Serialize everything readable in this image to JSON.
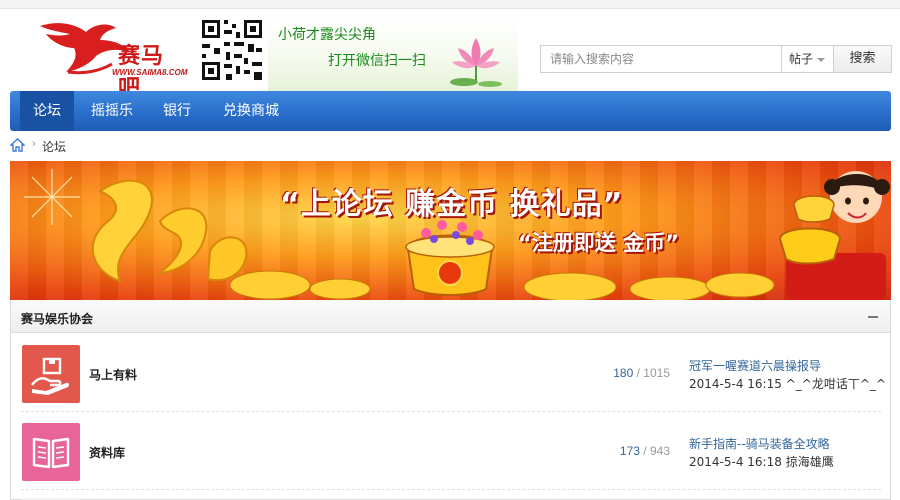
{
  "brand": {
    "logo_text": "赛马吧",
    "logo_url": "WWW.SAIMA8.COM",
    "brand_color": "#d01818"
  },
  "promo": {
    "line1": "小荷才露尖尖角",
    "line2": "打开微信扫一扫"
  },
  "search": {
    "placeholder": "请输入搜索内容",
    "type_label": "帖子",
    "button_label": "搜索"
  },
  "nav": {
    "items": [
      {
        "label": "论坛",
        "active": true
      },
      {
        "label": "摇摇乐",
        "active": false
      },
      {
        "label": "银行",
        "active": false
      },
      {
        "label": "兑换商城",
        "active": false
      }
    ],
    "color": "#2a6fcb"
  },
  "breadcrumb": {
    "current": "论坛"
  },
  "banner": {
    "headline": "“上论坛 赚金币 换礼品”",
    "subline": "“注册即送 金币”"
  },
  "section": {
    "title": "赛马娱乐协会",
    "forums": [
      {
        "name": "马上有料",
        "threads": "180",
        "posts": "1015",
        "last_title": "冠军一喔赛道六晨操报导",
        "last_time": "2014-5-4 16:15",
        "last_user": "^_^龙咁话丅^_^",
        "icon": "hand-box-icon",
        "icon_color": "#e2584c"
      },
      {
        "name": "资料库",
        "threads": "173",
        "posts": "943",
        "last_title": "新手指南--骑马装备全攻略",
        "last_time": "2014-5-4 16:18",
        "last_user": "掠海雄鹰",
        "icon": "open-book-icon",
        "icon_color": "#e8659a"
      }
    ]
  }
}
